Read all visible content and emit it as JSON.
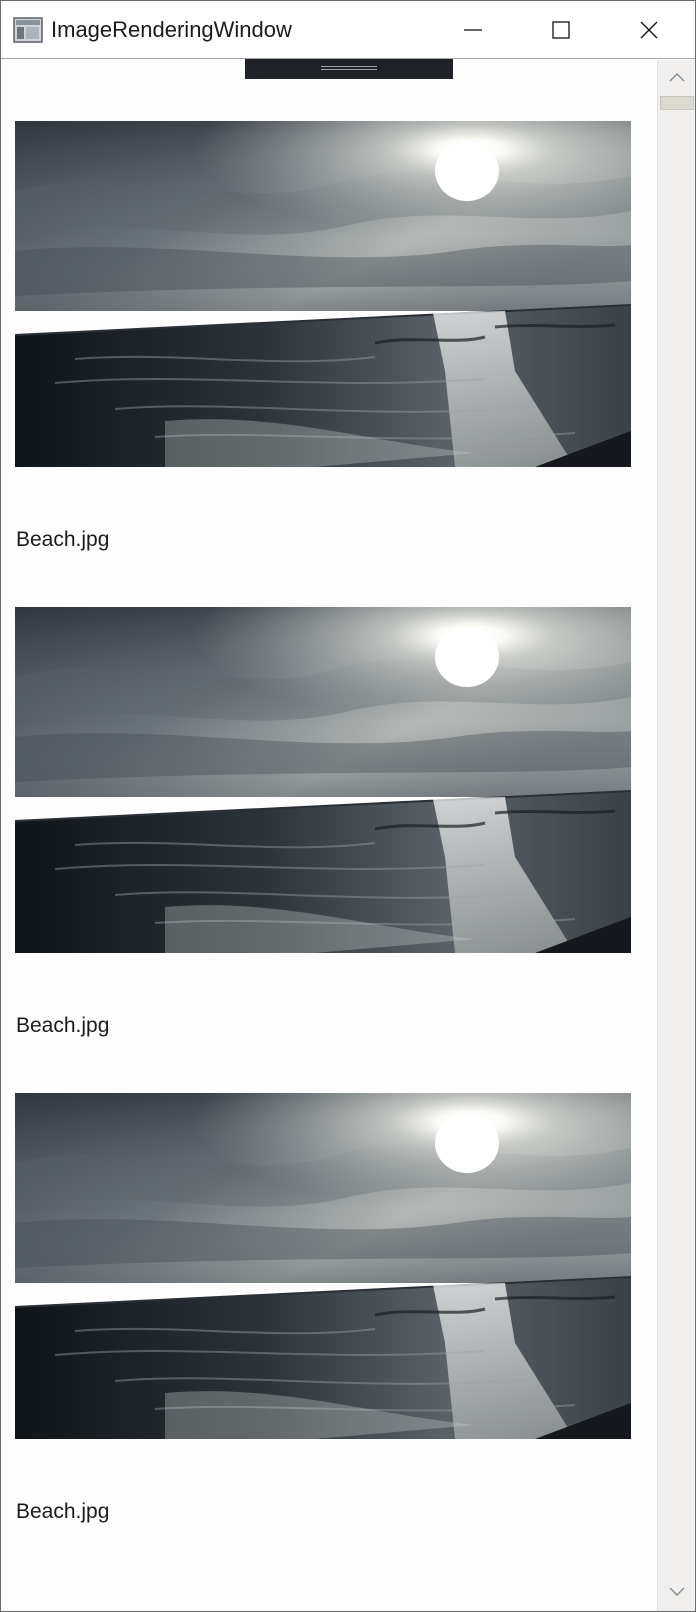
{
  "window": {
    "title": "ImageRenderingWindow",
    "app_icon": "app-window-icon",
    "controls": {
      "minimize_icon": "minimize-icon",
      "maximize_icon": "maximize-icon",
      "close_icon": "close-icon"
    }
  },
  "images": [
    {
      "caption": "Beach.jpg",
      "scene": "beach-sunset-photo"
    },
    {
      "caption": "Beach.jpg",
      "scene": "beach-sunset-photo"
    },
    {
      "caption": "Beach.jpg",
      "scene": "beach-sunset-photo"
    }
  ],
  "scrollbar": {
    "up_icon": "chevron-up-icon",
    "down_icon": "chevron-down-icon",
    "position": 0.0
  },
  "colors": {
    "sky_dark": "#3e4650",
    "sky_light": "#d8dad6",
    "sea_dark": "#12171b",
    "glare": "#f4f4ef"
  }
}
